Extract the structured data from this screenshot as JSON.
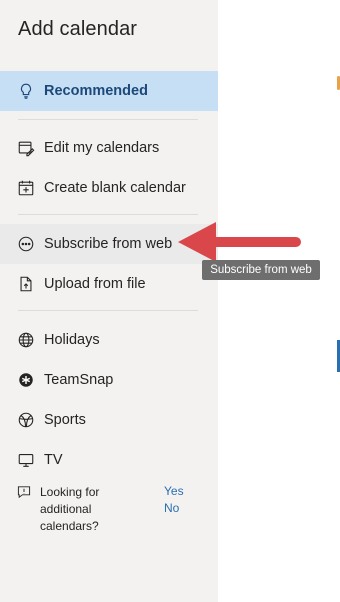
{
  "panel": {
    "title": "Add calendar",
    "items": [
      {
        "label": "Recommended",
        "icon": "lightbulb-icon"
      },
      {
        "label": "Edit my calendars",
        "icon": "calendar-edit-icon"
      },
      {
        "label": "Create blank calendar",
        "icon": "calendar-add-icon"
      },
      {
        "label": "Subscribe from web",
        "icon": "more-circle-icon"
      },
      {
        "label": "Upload from file",
        "icon": "file-upload-icon"
      },
      {
        "label": "Holidays",
        "icon": "globe-icon"
      },
      {
        "label": "TeamSnap",
        "icon": "teamsnap-icon"
      },
      {
        "label": "Sports",
        "icon": "sports-ball-icon"
      },
      {
        "label": "TV",
        "icon": "tv-icon"
      }
    ],
    "footer": {
      "text": "Looking for additional calendars?",
      "yes": "Yes",
      "no": "No",
      "icon": "feedback-icon"
    }
  },
  "tooltip": {
    "text": "Subscribe from web"
  },
  "annotation": {
    "arrow_color": "#d9474a"
  },
  "colors": {
    "selected_bg": "#c7dff4",
    "selected_text": "#1b4a7a",
    "link": "#2a6fb0",
    "sidebar_bg": "#f3f2f1"
  }
}
